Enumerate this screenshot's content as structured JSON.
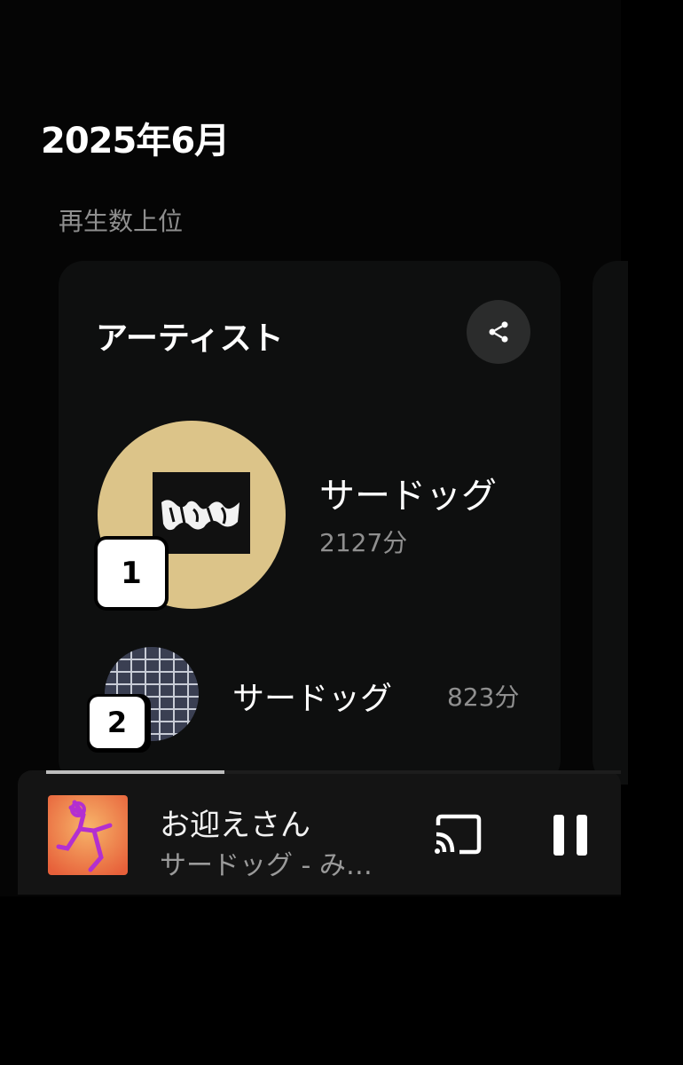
{
  "header": {
    "month": "2025年6月"
  },
  "section": {
    "label": "再生数上位"
  },
  "card": {
    "title": "アーティスト",
    "share_icon": "share-icon",
    "items": [
      {
        "rank": "1",
        "name": "サードッグ",
        "minutes": "2127分"
      },
      {
        "rank": "2",
        "name": "サードッグ",
        "minutes": "823分"
      }
    ]
  },
  "player": {
    "title": "お迎えさん",
    "subtitle": "サードッグ - み…",
    "cast_icon": "cast-icon",
    "pause_icon": "pause-icon",
    "progress": 0.31
  },
  "colors": {
    "background": "#000000",
    "card": "#0e0f0f",
    "muted_text": "#8f8f8f",
    "art1": "#dcc489",
    "player_bg": "#141414"
  }
}
